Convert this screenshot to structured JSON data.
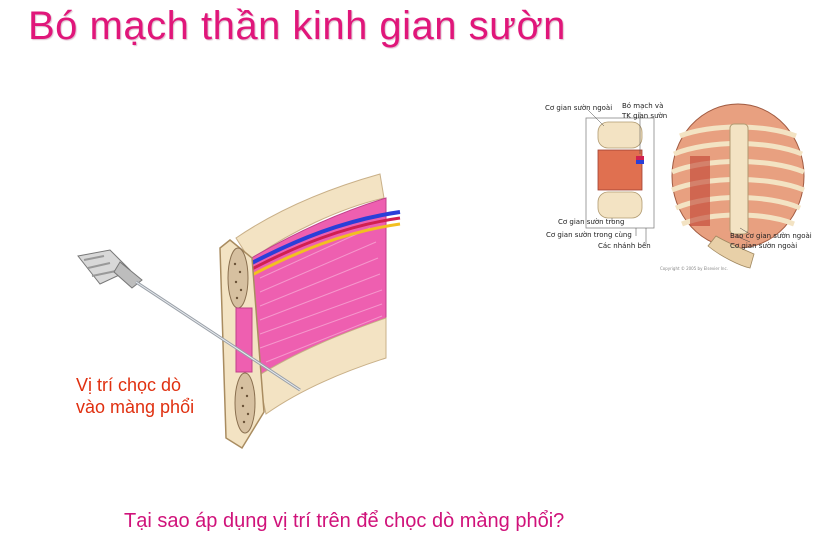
{
  "slide": {
    "title": "Bó mạch thần kinh gian sườn",
    "question": "Tại sao áp dụng vị trí trên để chọc dò màng phổi?"
  },
  "left_figure": {
    "caption_line1": "Vị trí chọc dò",
    "caption_line2": "vào màng phổi"
  },
  "right_figure": {
    "labels": {
      "co_gian_suon_ngoai_top": "Cơ gian sườn ngoài",
      "bo_mach_va": "Bó mạch và",
      "tk_gian_suon": "TK gian sườn",
      "co_gian_suon_trong": "Cơ gian sườn trong",
      "co_gian_suon_trong_cung": "Cơ gian sườn trong cùng",
      "cac_nhanh_ben": "Các nhánh bên",
      "bao_co_gian_suon_ngoai": "Bao cơ gian sườn ngoài",
      "co_gian_suon_ngoai_right": "Cơ gian sườn ngoài",
      "copyright": "Copyright © 2005 by Elsevier Inc."
    }
  },
  "colors": {
    "title": "#e0167a",
    "caption": "#e03010",
    "question": "#d0127a",
    "muscle": "#ee5fb0",
    "bone": "#f3e3c3",
    "nerve_blue": "#2a3fd8",
    "vessel_red": "#d02050",
    "nerve_yellow": "#f2c020"
  }
}
